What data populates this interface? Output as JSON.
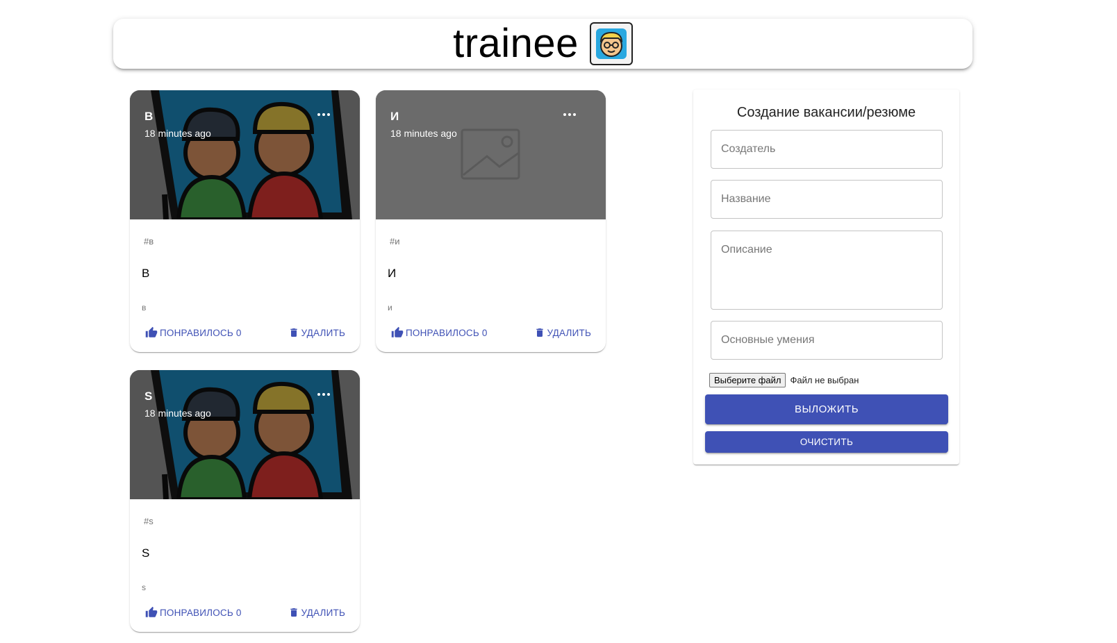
{
  "header": {
    "brand": "trainee",
    "logo_icon": "avatar-face-icon"
  },
  "colors": {
    "primary": "#3f51b5",
    "media_gray": "#6b6b6b"
  },
  "posts": [
    {
      "title": "В",
      "time": "18 minutes ago",
      "tags": "#в",
      "heading": "В",
      "message": "в",
      "like_label": "ПОНРАВИЛОСЬ 0",
      "delete_label": "УДАЛИТЬ",
      "image": "two-people-photo"
    },
    {
      "title": "И",
      "time": "18 minutes ago",
      "tags": "#и",
      "heading": "И",
      "message": "и",
      "like_label": "ПОНРАВИЛОСЬ 0",
      "delete_label": "УДАЛИТЬ",
      "image": "image-placeholder"
    },
    {
      "title": "S",
      "time": "18 minutes ago",
      "tags": "#s",
      "heading": "S",
      "message": "s",
      "like_label": "ПОНРАВИЛОСЬ 0",
      "delete_label": "УДАЛИТЬ",
      "image": "two-people-photo"
    }
  ],
  "form": {
    "title": "Создание вакансии/резюме",
    "creator_placeholder": "Создатель",
    "name_placeholder": "Название",
    "description_placeholder": "Описание",
    "skills_placeholder": "Основные умения",
    "file_button": "Выберите файл",
    "file_status": "Файл не выбран",
    "submit_label": "ВЫЛОЖИТЬ",
    "clear_label": "ОЧИСТИТЬ"
  }
}
